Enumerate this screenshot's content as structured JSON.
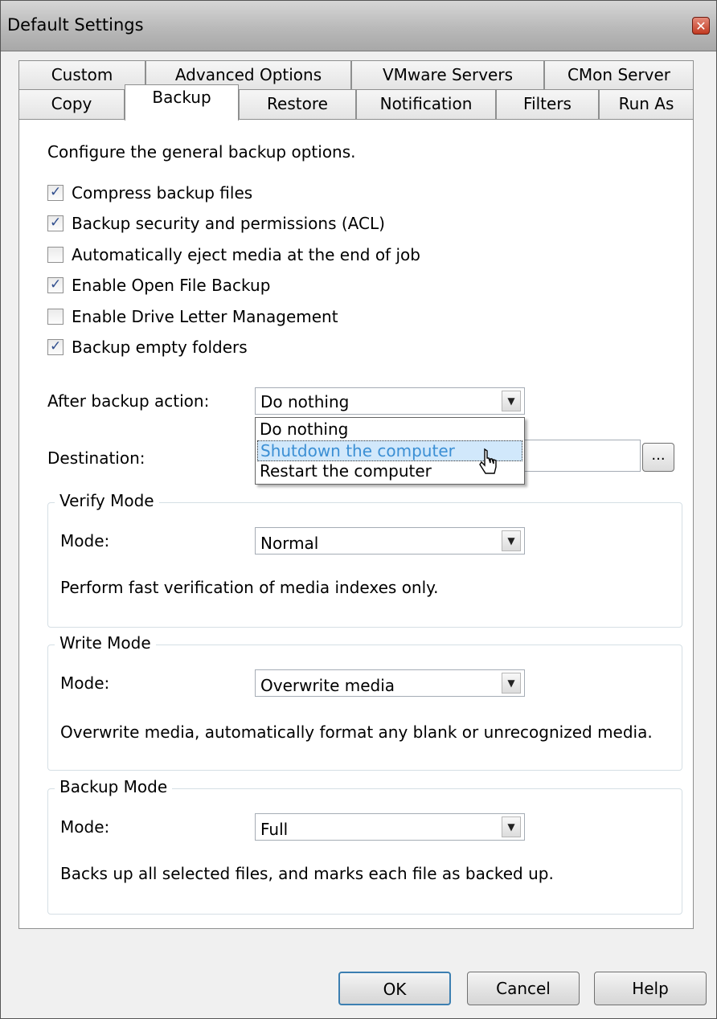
{
  "window": {
    "title": "Default Settings",
    "close_label": "✕"
  },
  "tabs_row1": [
    "Custom",
    "Advanced Options",
    "VMware Servers",
    "CMon Server"
  ],
  "tabs_row2": [
    "Copy",
    "Backup",
    "Restore",
    "Notification",
    "Filters",
    "Run As"
  ],
  "active_tab": "Backup",
  "intro": "Configure the general backup options.",
  "checkboxes": [
    {
      "label": "Compress backup files",
      "checked": true
    },
    {
      "label": "Backup security and permissions (ACL)",
      "checked": true
    },
    {
      "label": "Automatically eject media at the end of job",
      "checked": false
    },
    {
      "label": "Enable Open File Backup",
      "checked": true
    },
    {
      "label": "Enable Drive Letter Management",
      "checked": false
    },
    {
      "label": "Backup empty folders",
      "checked": true
    }
  ],
  "after_backup": {
    "label": "After backup action:",
    "value": "Do nothing",
    "options": [
      "Do nothing",
      "Shutdown the computer",
      "Restart the computer"
    ],
    "highlighted": "Shutdown the computer"
  },
  "destination": {
    "label": "Destination:",
    "browse_label": "..."
  },
  "verify_mode": {
    "title": "Verify Mode",
    "mode_label": "Mode:",
    "value": "Normal",
    "description": "Perform fast verification of media indexes only."
  },
  "write_mode": {
    "title": "Write Mode",
    "mode_label": "Mode:",
    "value": "Overwrite media",
    "description": "Overwrite media, automatically format any blank or unrecognized media."
  },
  "backup_mode": {
    "title": "Backup Mode",
    "mode_label": "Mode:",
    "value": "Full",
    "description": "Backs up all selected files, and marks each file as backed up."
  },
  "buttons": {
    "ok": "OK",
    "cancel": "Cancel",
    "help": "Help"
  },
  "colors": {
    "accent_selection": "#d1e8fb",
    "selected_text": "#3b8fd4",
    "check_mark": "#304e8e"
  }
}
